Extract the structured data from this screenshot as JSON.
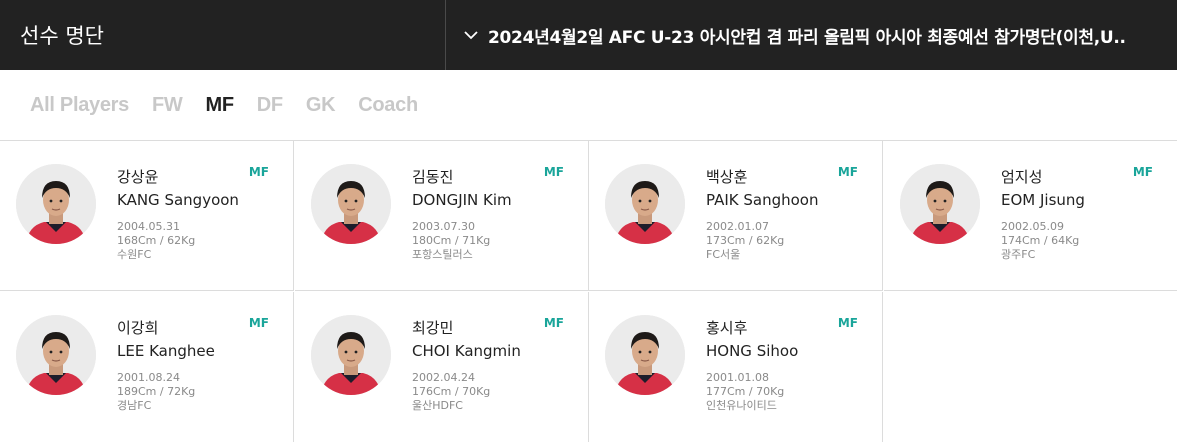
{
  "header": {
    "title": "선수 명단",
    "selected_roster": "2024년4월2일 AFC U-23 아시안컵 겸 파리 올림픽 아시아 최종예선 참가명단(이천,U.."
  },
  "tabs": [
    {
      "label": "All Players",
      "active": false
    },
    {
      "label": "FW",
      "active": false
    },
    {
      "label": "MF",
      "active": true
    },
    {
      "label": "DF",
      "active": false
    },
    {
      "label": "GK",
      "active": false
    },
    {
      "label": "Coach",
      "active": false
    }
  ],
  "players": [
    {
      "name_ko": "강상윤",
      "name_en": "KANG Sangyoon",
      "position": "MF",
      "birth": "2004.05.31",
      "body": "168Cm / 62Kg",
      "club": "수원FC"
    },
    {
      "name_ko": "김동진",
      "name_en": "DONGJIN Kim",
      "position": "MF",
      "birth": "2003.07.30",
      "body": "180Cm / 71Kg",
      "club": "포항스틸러스"
    },
    {
      "name_ko": "백상훈",
      "name_en": "PAIK Sanghoon",
      "position": "MF",
      "birth": "2002.01.07",
      "body": "173Cm / 62Kg",
      "club": "FC서울"
    },
    {
      "name_ko": "엄지성",
      "name_en": "EOM Jisung",
      "position": "MF",
      "birth": "2002.05.09",
      "body": "174Cm / 64Kg",
      "club": "광주FC"
    },
    {
      "name_ko": "이강희",
      "name_en": "LEE Kanghee",
      "position": "MF",
      "birth": "2001.08.24",
      "body": "189Cm / 72Kg",
      "club": "경남FC"
    },
    {
      "name_ko": "최강민",
      "name_en": "CHOI Kangmin",
      "position": "MF",
      "birth": "2002.04.24",
      "body": "176Cm / 70Kg",
      "club": "울산HDFC"
    },
    {
      "name_ko": "홍시후",
      "name_en": "HONG Sihoo",
      "position": "MF",
      "birth": "2001.01.08",
      "body": "177Cm / 70Kg",
      "club": "인천유나이티드"
    }
  ],
  "colors": {
    "header_bg": "#222222",
    "position_accent": "#1aa59a",
    "jersey_red": "#d63046"
  }
}
